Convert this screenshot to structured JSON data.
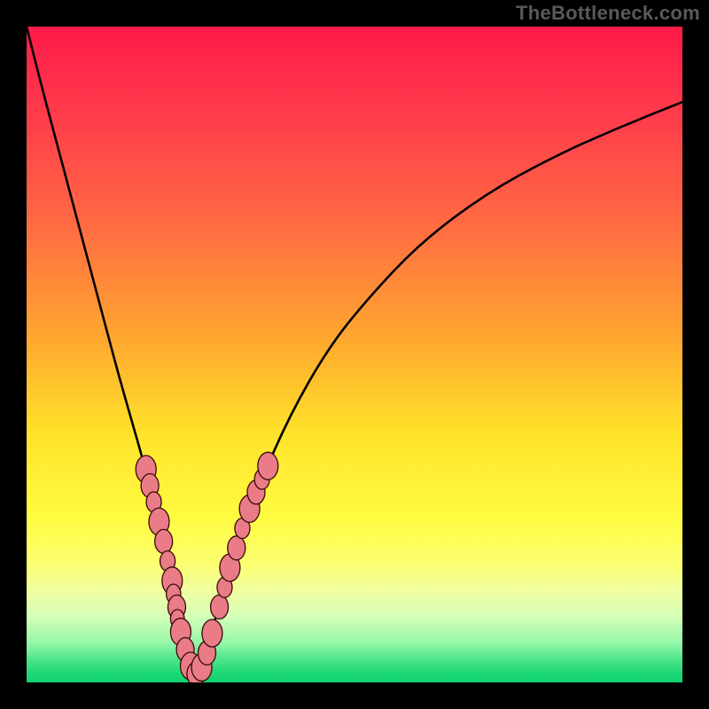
{
  "watermark_text": "TheBottleneck.com",
  "colors": {
    "frame": "#000000",
    "curve": "#000000",
    "marker_fill": "#e97c87",
    "marker_stroke": "#3a0a0a"
  },
  "gradient_stops": [
    {
      "offset": 0,
      "color": "#ff1a4a"
    },
    {
      "offset": 0.14,
      "color": "#ff3d4b"
    },
    {
      "offset": 0.3,
      "color": "#ff6a42"
    },
    {
      "offset": 0.48,
      "color": "#ffa92f"
    },
    {
      "offset": 0.62,
      "color": "#ffe22a"
    },
    {
      "offset": 0.75,
      "color": "#fffc42"
    },
    {
      "offset": 0.82,
      "color": "#fcff72"
    },
    {
      "offset": 0.86,
      "color": "#f0ffa0"
    },
    {
      "offset": 0.9,
      "color": "#d4ffb8"
    },
    {
      "offset": 0.94,
      "color": "#95f7a8"
    },
    {
      "offset": 0.965,
      "color": "#4de58a"
    },
    {
      "offset": 0.985,
      "color": "#1fd877"
    },
    {
      "offset": 1.0,
      "color": "#0fd272"
    }
  ],
  "chart_data": {
    "type": "line",
    "title": "",
    "xlabel": "",
    "ylabel": "",
    "xlim": [
      0,
      100
    ],
    "ylim": [
      0,
      100
    ],
    "series": [
      {
        "name": "bottleneck-curve",
        "x": [
          0,
          2,
          4,
          6,
          8,
          10,
          12,
          14,
          16,
          18,
          20,
          21,
          22,
          23,
          24,
          25,
          26,
          27,
          28,
          30,
          32,
          35,
          40,
          46,
          52,
          60,
          70,
          80,
          90,
          100
        ],
        "y": [
          100,
          92,
          84.5,
          77,
          69.5,
          62,
          54.5,
          47,
          40,
          33,
          25.5,
          22,
          18,
          14,
          9,
          4,
          0.5,
          3,
          7,
          14,
          21,
          29,
          40.5,
          51,
          58.5,
          67,
          74.5,
          80,
          84.5,
          88.5
        ]
      }
    ],
    "markers": [
      {
        "x": 18.2,
        "y": 32.5,
        "r": 1.55
      },
      {
        "x": 18.8,
        "y": 30.0,
        "r": 1.35
      },
      {
        "x": 19.4,
        "y": 27.5,
        "r": 1.15
      },
      {
        "x": 20.2,
        "y": 24.5,
        "r": 1.55
      },
      {
        "x": 20.9,
        "y": 21.5,
        "r": 1.35
      },
      {
        "x": 21.5,
        "y": 18.5,
        "r": 1.15
      },
      {
        "x": 22.2,
        "y": 15.5,
        "r": 1.55
      },
      {
        "x": 22.4,
        "y": 13.5,
        "r": 1.1
      },
      {
        "x": 22.9,
        "y": 11.5,
        "r": 1.35
      },
      {
        "x": 23.0,
        "y": 9.7,
        "r": 1.05
      },
      {
        "x": 23.5,
        "y": 7.7,
        "r": 1.55
      },
      {
        "x": 24.2,
        "y": 5.0,
        "r": 1.35
      },
      {
        "x": 25.0,
        "y": 2.5,
        "r": 1.55
      },
      {
        "x": 25.8,
        "y": 1.3,
        "r": 1.35
      },
      {
        "x": 26.7,
        "y": 2.3,
        "r": 1.55
      },
      {
        "x": 27.5,
        "y": 4.5,
        "r": 1.35
      },
      {
        "x": 28.3,
        "y": 7.5,
        "r": 1.55
      },
      {
        "x": 29.4,
        "y": 11.5,
        "r": 1.35
      },
      {
        "x": 30.2,
        "y": 14.5,
        "r": 1.15
      },
      {
        "x": 31.0,
        "y": 17.5,
        "r": 1.55
      },
      {
        "x": 32.0,
        "y": 20.5,
        "r": 1.35
      },
      {
        "x": 32.9,
        "y": 23.5,
        "r": 1.15
      },
      {
        "x": 34.0,
        "y": 26.5,
        "r": 1.55
      },
      {
        "x": 35.0,
        "y": 29.0,
        "r": 1.35
      },
      {
        "x": 35.9,
        "y": 31.0,
        "r": 1.15
      },
      {
        "x": 36.8,
        "y": 33.0,
        "r": 1.55
      }
    ],
    "baseline": {
      "description": "green baseline band at bottom",
      "y_range": [
        0,
        3
      ]
    }
  }
}
